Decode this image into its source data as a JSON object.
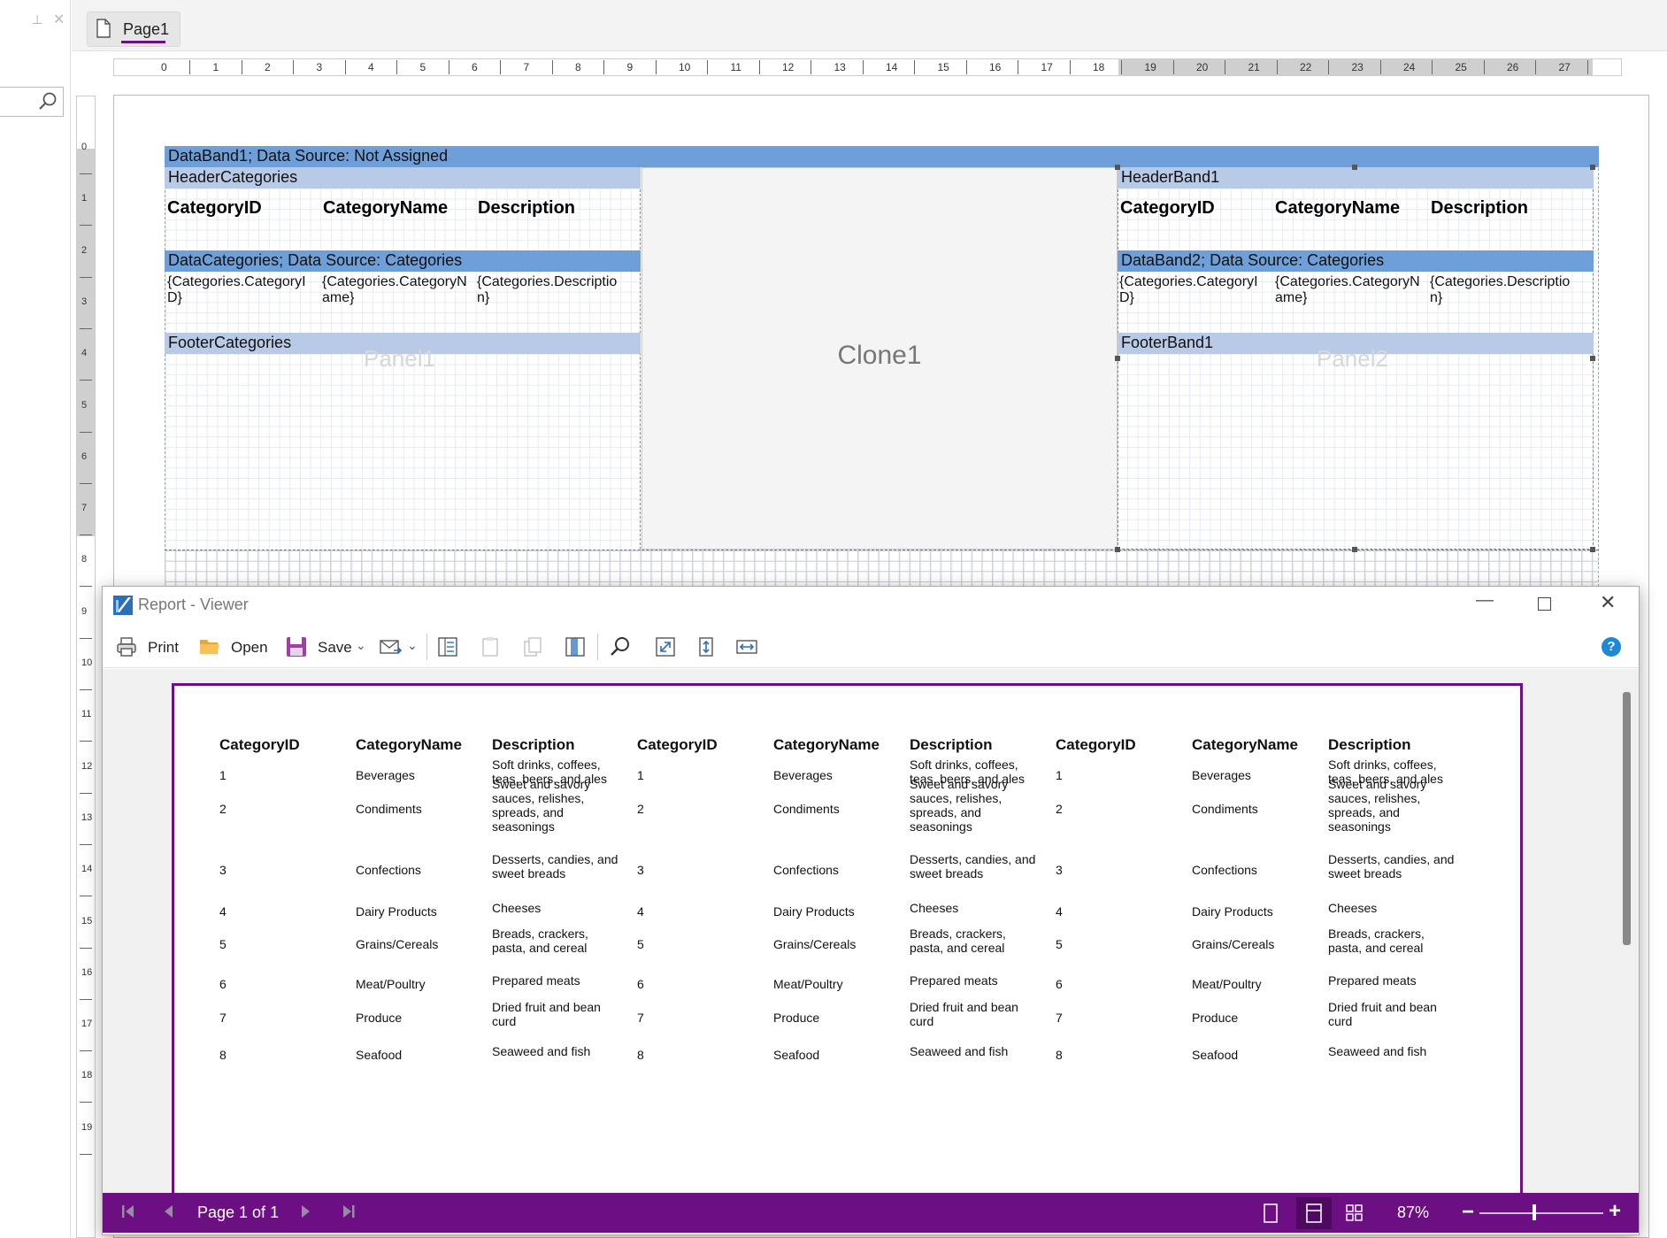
{
  "designer": {
    "page_tab": "Page1",
    "hruler_numbers": [
      "0",
      "1",
      "2",
      "3",
      "4",
      "5",
      "6",
      "7",
      "8",
      "9",
      "10",
      "11",
      "12",
      "13",
      "14",
      "15",
      "16",
      "17",
      "18",
      "19",
      "20",
      "21",
      "22",
      "23",
      "24",
      "25",
      "26",
      "27"
    ],
    "vruler_numbers": [
      "0",
      "1",
      "2",
      "3",
      "4",
      "5",
      "6",
      "7",
      "8",
      "9",
      "10",
      "11",
      "12",
      "13",
      "14",
      "15",
      "16",
      "17",
      "18",
      "19"
    ],
    "databand1": "DataBand1; Data Source: Not Assigned",
    "panel1": {
      "label": "Panel1",
      "header": "HeaderCategories",
      "columns": [
        "CategoryID",
        "CategoryName",
        "Description"
      ],
      "data": "DataCategories; Data Source: Categories",
      "cells": [
        "{Categories.CategoryI\nD}",
        "{Categories.CategoryN\name}",
        "{Categories.Descriptio\nn}"
      ],
      "footer": "FooterCategories"
    },
    "clone": "Clone1",
    "panel2": {
      "label": "Panel2",
      "header": "HeaderBand1",
      "columns": [
        "CategoryID",
        "CategoryName",
        "Description"
      ],
      "data": "DataBand2; Data Source: Categories",
      "cells": [
        "{Categories.CategoryI\nD}",
        "{Categories.CategoryN\name}",
        "{Categories.Descriptio\nn}"
      ],
      "footer": "FooterBand1"
    }
  },
  "viewer": {
    "title": "Report - Viewer",
    "toolbar": {
      "print": "Print",
      "open": "Open",
      "save": "Save"
    },
    "report": {
      "columns": [
        "CategoryID",
        "CategoryName",
        "Description"
      ],
      "rows": [
        [
          "1",
          "Beverages",
          "Soft drinks, coffees,\nteas, beers, and ales"
        ],
        [
          "2",
          "Condiments",
          "Sweet and savory\nsauces, relishes,\nspreads, and\nseasonings"
        ],
        [
          "3",
          "Confections",
          "Desserts, candies, and\nsweet breads"
        ],
        [
          "4",
          "Dairy Products",
          "Cheeses"
        ],
        [
          "5",
          "Grains/Cereals",
          "Breads, crackers,\npasta, and cereal"
        ],
        [
          "6",
          "Meat/Poultry",
          "Prepared meats"
        ],
        [
          "7",
          "Produce",
          "Dried fruit and bean\ncurd"
        ],
        [
          "8",
          "Seafood",
          "Seaweed and fish"
        ]
      ]
    },
    "status": {
      "page": "Page 1 of 1",
      "zoom": "87%"
    }
  },
  "colors": {
    "band_dark": "#6f9fd8",
    "band_light": "#b8cae6",
    "status_bar": "#6b0f82",
    "accent": "#6d0f85"
  }
}
